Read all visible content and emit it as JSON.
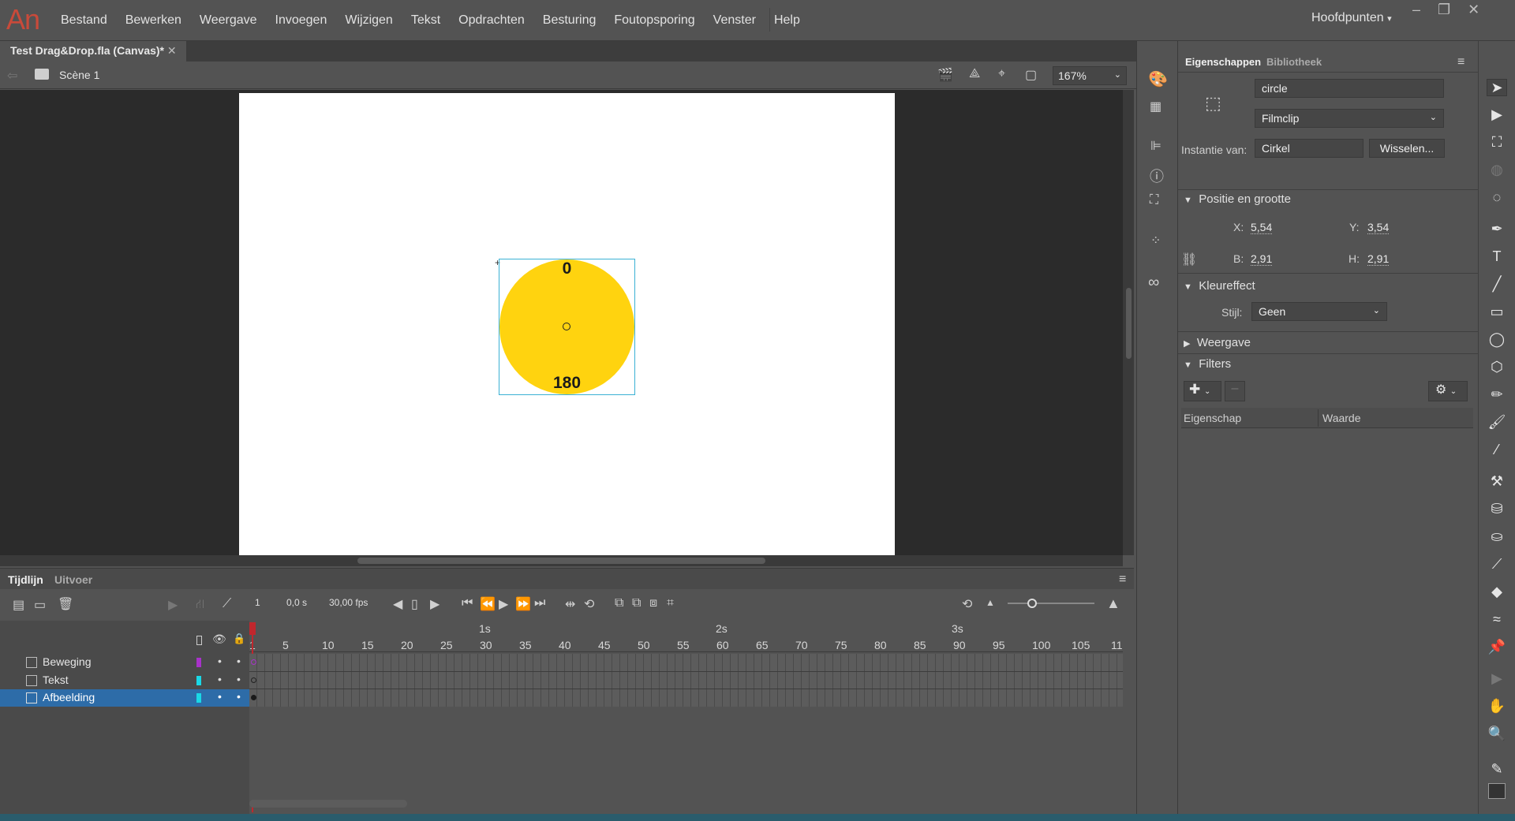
{
  "app": {
    "logo": "An"
  },
  "menu": [
    "Bestand",
    "Bewerken",
    "Weergave",
    "Invoegen",
    "Wijzigen",
    "Tekst",
    "Opdrachten",
    "Besturing",
    "Foutopsporing",
    "Venster",
    "Help"
  ],
  "workspace": "Hoofdpunten",
  "document": {
    "tab": "Test Drag&Drop.fla (Canvas)*",
    "scene": "Scène 1",
    "zoom": "167%"
  },
  "stage": {
    "top_label": "0",
    "bottom_label": "180",
    "fill_color": "#ffd30f"
  },
  "properties": {
    "tabs": [
      "Eigenschappen",
      "Bibliotheek"
    ],
    "instance_name": "circle",
    "symbol_type": "Filmclip",
    "instance_of_label": "Instantie van:",
    "instance_of": "Cirkel",
    "swap_button": "Wisselen...",
    "position_section": "Positie en grootte",
    "x_label": "X:",
    "x": "5,54",
    "y_label": "Y:",
    "y": "3,54",
    "w_label": "B:",
    "w": "2,91",
    "h_label": "H:",
    "h": "2,91",
    "color_section": "Kleureffect",
    "style_label": "Stijl:",
    "style": "Geen",
    "display_section": "Weergave",
    "filters_section": "Filters",
    "filter_col_property": "Eigenschap",
    "filter_col_value": "Waarde"
  },
  "timeline": {
    "tabs": [
      "Tijdlijn",
      "Uitvoer"
    ],
    "current_frame": "1",
    "time": "0,0 s",
    "fps": "30,00 fps",
    "seconds_markers": [
      "1s",
      "2s",
      "3s"
    ],
    "frame_numbers": [
      "1",
      "5",
      "10",
      "15",
      "20",
      "25",
      "30",
      "35",
      "40",
      "45",
      "50",
      "55",
      "60",
      "65",
      "70",
      "75",
      "80",
      "85",
      "90",
      "95",
      "100",
      "105",
      "11"
    ],
    "layers": [
      {
        "name": "Beweging",
        "color": "#a832c9",
        "selected": false
      },
      {
        "name": "Tekst",
        "color": "#1ad8e6",
        "selected": false
      },
      {
        "name": "Afbeelding",
        "color": "#1ad8e6",
        "selected": true
      }
    ]
  }
}
